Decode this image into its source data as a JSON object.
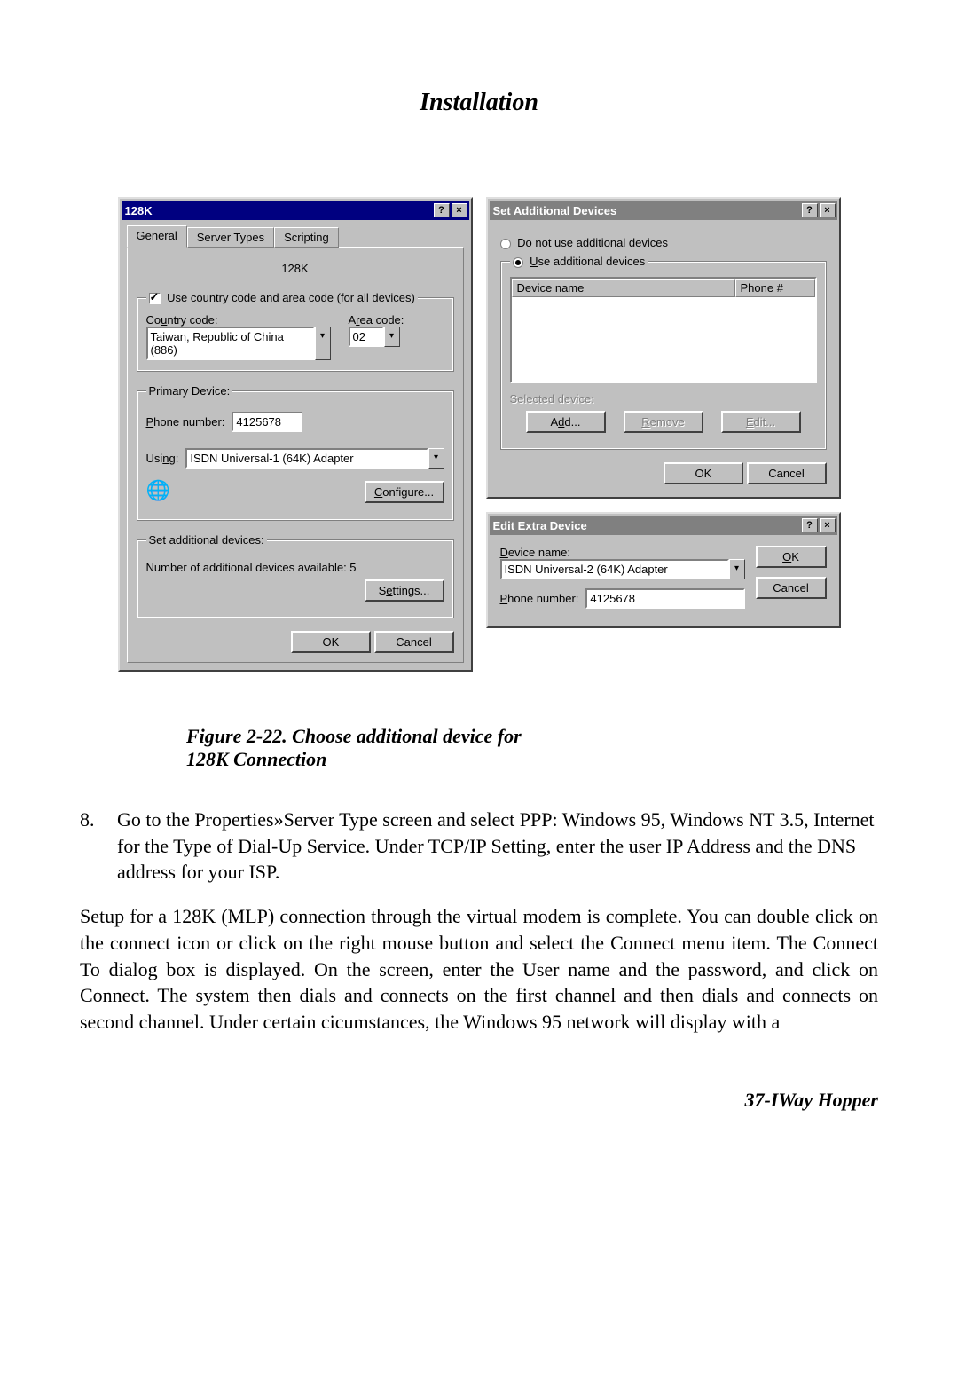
{
  "page_title": "Installation",
  "dialog128k": {
    "title": "128K",
    "tabs": [
      "General",
      "Server Types",
      "Scripting"
    ],
    "connection_name": "128K",
    "use_cc_legend_checkbox": true,
    "use_cc_legend": "Use country code and area code (for all devices)",
    "country_code_label": "Country code:",
    "country_code_value": "Taiwan, Republic of China (886)",
    "area_code_label": "Area code:",
    "area_code_value": "02",
    "primary_legend": "Primary Device:",
    "phone_label": "Phone number:",
    "phone_value": "4125678",
    "using_label": "Using",
    "using_value": "ISDN Universal-1 (64K) Adapter",
    "configure_btn": "Configure...",
    "set_add_legend": "Set additional devices:",
    "set_add_text": "Number of additional devices available:   5",
    "settings_btn": "Settings...",
    "ok_btn": "OK",
    "cancel_btn": "Cancel"
  },
  "set_additional": {
    "title": "Set Additional Devices",
    "radio_no": "Do not use additional devices",
    "radio_yes": "Use additional devices",
    "col_device": "Device name",
    "col_phone": "Phone #",
    "selected_label": "Selected device:",
    "add_btn": "Add...",
    "remove_btn": "Remove",
    "edit_btn": "Edit...",
    "ok_btn": "OK",
    "cancel_btn": "Cancel"
  },
  "edit_extra": {
    "title": "Edit Extra Device",
    "device_label": "Device name:",
    "device_value": "ISDN Universal-2 (64K) Adapter",
    "phone_label": "Phone number:",
    "phone_value": "4125678",
    "ok_btn": "OK",
    "cancel_btn": "Cancel"
  },
  "caption_line1": "Figure 2-22. Choose additional device for",
  "caption_line2": "128K Connection",
  "step8_num": "8.",
  "step8_text": "Go to the Properties»Server Type screen and select PPP: Windows 95, Windows NT 3.5, Internet for the Type of Dial-Up Service.  Under TCP/IP Setting, enter the user IP Address and the DNS address for your ISP.",
  "para": "Setup for a 128K (MLP) connection through the virtual modem is complete.  You can double click on the connect icon or click on the right mouse button and select the Connect menu item.  The Connect To dialog box is displayed.  On the screen, enter the User name and the password, and click on Connect.  The system then dials and connects on the first channel and then dials and connects on second channel.  Under certain cicumstances, the Windows 95 network will display with a",
  "footer": "37-IWay Hopper"
}
